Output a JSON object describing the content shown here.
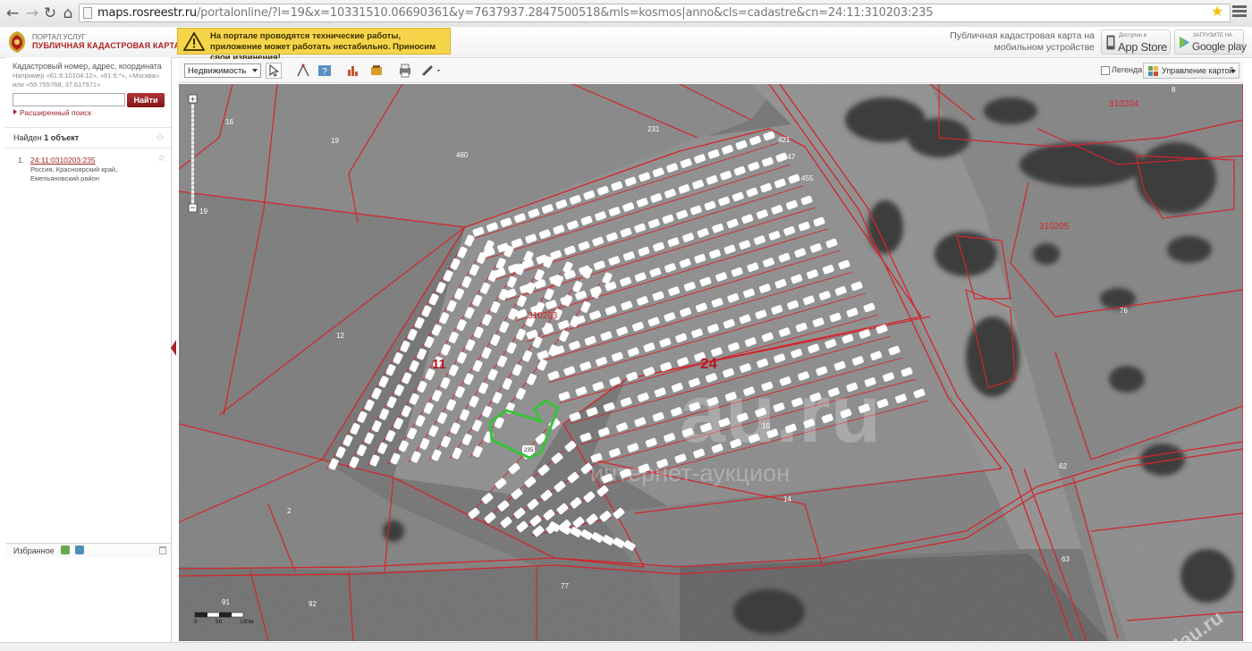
{
  "browser": {
    "url_host": "maps.rosreestr.ru",
    "url_path": "/portalonline/?l=19&x=10331510.06690361&y=7637937.2847500518&mls=kosmos|anno&cls=cadastre&cn=24:11:310203:235",
    "nav_icons": [
      "back-arrow-icon",
      "forward-arrow-icon",
      "reload-icon",
      "home-icon"
    ]
  },
  "header": {
    "portal_subtitle": "ПОРТАЛ УСЛУГ",
    "portal_title": "ПУБЛИЧНАЯ КАДАСТРОВАЯ КАРТА",
    "warning": "На портале проводятся технические работы, приложение может работать нестабильно. Приносим свои извинения!",
    "mobile_text": "Публичная кадастровая карта на мобильном устройстве",
    "app_store_small": "Доступно в",
    "app_store_label": "App Store",
    "google_play_small": "ЗАГРУЗИТЕ НА",
    "google_play_label": "Google play"
  },
  "search": {
    "hint": "Кадастровый номер, адрес, координата",
    "example": "Например «61:6:10104:12», «61:6:*», «Москва» или «55.755768, 37.617671»",
    "value": "",
    "button": "Найти",
    "advanced": "Расширенный поиск"
  },
  "results": {
    "found_prefix": "Найден ",
    "found_count": "1 объект",
    "items": [
      {
        "num": "1.",
        "cadastral_number": "24:11:0310203:235",
        "address": "Россия, Красноярский край, Емельяновский район"
      }
    ]
  },
  "favorites": {
    "label": "Избранное"
  },
  "toolbar": {
    "layer_select": "Недвижимость",
    "legend_label": "Легенда",
    "manage_map": "Управление картой"
  },
  "map": {
    "zoom_level": "19",
    "scale_labels": [
      "0",
      "50",
      "100м"
    ],
    "blocks": [
      "310204",
      "310205",
      "310203"
    ],
    "big_labels": [
      "11",
      "24"
    ],
    "parcel_labels": [
      "16",
      "19",
      "460",
      "231",
      "421",
      "447",
      "455",
      "12",
      "2",
      "10",
      "14",
      "62",
      "63",
      "76",
      "77",
      "91",
      "92",
      "8",
      "235"
    ],
    "selected_parcel": "235",
    "watermark": "au.ru",
    "watermark_sub": "интернет-аукцион",
    "corner_watermark": "24au.ru",
    "colors": {
      "boundary": "#d2262b",
      "selected": "#37c23a"
    }
  }
}
